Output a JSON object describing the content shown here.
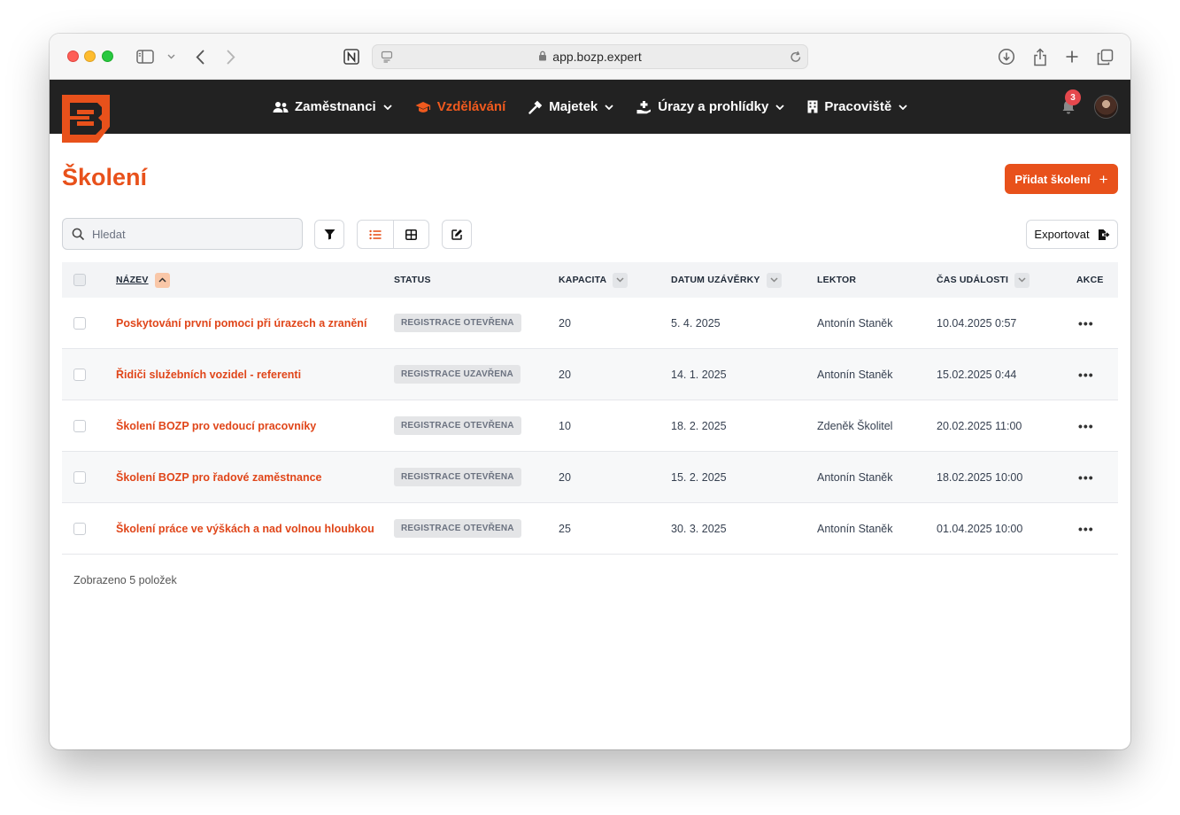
{
  "browser": {
    "url": "app.bozp.expert"
  },
  "nav": {
    "items": [
      {
        "label": "Zaměstnanci",
        "icon": "users-icon",
        "active": false
      },
      {
        "label": "Vzdělávání",
        "icon": "graduation-cap-icon",
        "active": true
      },
      {
        "label": "Majetek",
        "icon": "hammer-icon",
        "active": false
      },
      {
        "label": "Úrazy a prohlídky",
        "icon": "hand-medical-icon",
        "active": false
      },
      {
        "label": "Pracoviště",
        "icon": "building-icon",
        "active": false
      }
    ],
    "notification_count": "3"
  },
  "page": {
    "title": "Školení",
    "add_button": "Přidat školení",
    "search_placeholder": "Hledat",
    "export_button": "Exportovat"
  },
  "table": {
    "columns": {
      "name": "NÁZEV",
      "status": "STATUS",
      "capacity": "KAPACITA",
      "deadline": "DATUM UZÁVĚRKY",
      "lecturer": "LEKTOR",
      "event_time": "ČAS UDÁLOSTI",
      "actions": "AKCE"
    },
    "rows": [
      {
        "name": "Poskytování první pomoci při úrazech a zranění",
        "status": "REGISTRACE OTEVŘENA",
        "capacity": "20",
        "deadline": "5. 4. 2025",
        "lecturer": "Antonín Staněk",
        "event_time": "10.04.2025 0:57"
      },
      {
        "name": "Řidiči služebních vozidel - referenti",
        "status": "REGISTRACE UZAVŘENA",
        "capacity": "20",
        "deadline": "14. 1. 2025",
        "lecturer": "Antonín Staněk",
        "event_time": "15.02.2025 0:44"
      },
      {
        "name": "Školení BOZP pro vedoucí pracovníky",
        "status": "REGISTRACE OTEVŘENA",
        "capacity": "10",
        "deadline": "18. 2. 2025",
        "lecturer": "Zdeněk Školitel",
        "event_time": "20.02.2025 11:00"
      },
      {
        "name": "Školení BOZP pro řadové zaměstnance",
        "status": "REGISTRACE OTEVŘENA",
        "capacity": "20",
        "deadline": "15. 2. 2025",
        "lecturer": "Antonín Staněk",
        "event_time": "18.02.2025 10:00"
      },
      {
        "name": "Školení práce ve výškách a nad volnou hloubkou",
        "status": "REGISTRACE OTEVŘENA",
        "capacity": "25",
        "deadline": "30. 3. 2025",
        "lecturer": "Antonín Staněk",
        "event_time": "01.04.2025 10:00"
      }
    ],
    "actions_label": "•••"
  },
  "footer": {
    "count_text": "Zobrazeno 5 položek"
  },
  "colors": {
    "accent": "#e8511b",
    "nav_bg": "#222222"
  }
}
